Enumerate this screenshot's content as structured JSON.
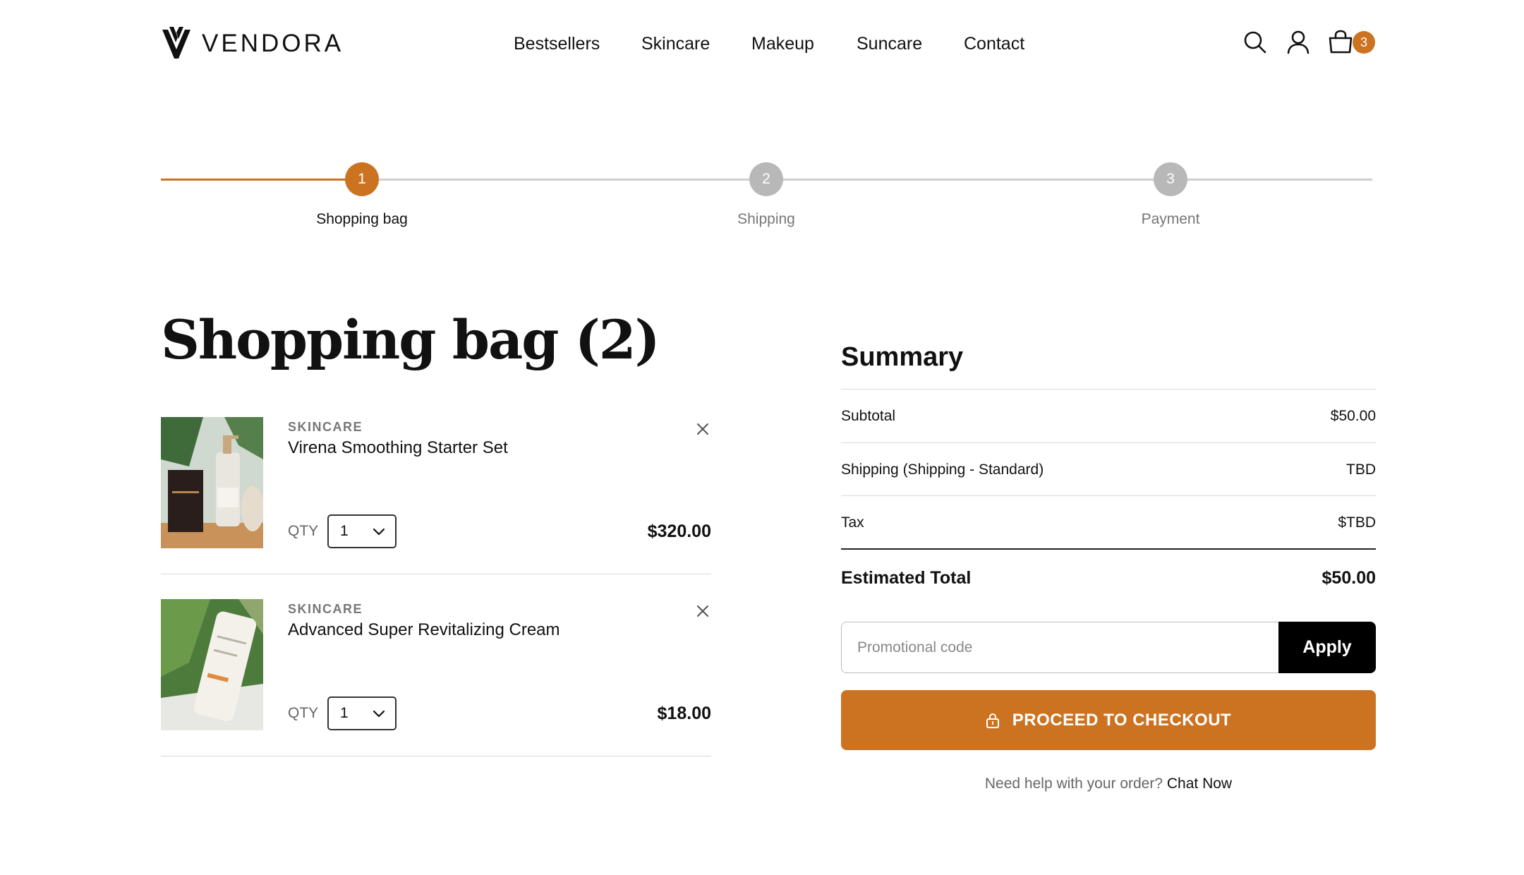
{
  "brand": {
    "name": "VENDORA"
  },
  "nav": {
    "items": [
      "Bestsellers",
      "Skincare",
      "Makeup",
      "Suncare",
      "Contact"
    ]
  },
  "header": {
    "icons": [
      "search-icon",
      "user-icon",
      "shopping-bag-icon"
    ],
    "cart_count": "3"
  },
  "colors": {
    "accent": "#cc7322",
    "inactive_step": "#b8b8b8",
    "dark": "#000000"
  },
  "stepper": {
    "steps": [
      {
        "number": "1",
        "label": "Shopping bag",
        "state": "active"
      },
      {
        "number": "2",
        "label": "Shipping",
        "state": "inactive"
      },
      {
        "number": "3",
        "label": "Payment",
        "state": "inactive"
      }
    ]
  },
  "bag": {
    "title": "Shopping bag (2)",
    "qty_label": "QTY",
    "items": [
      {
        "category": "SKINCARE",
        "name": "Virena Smoothing Starter Set",
        "qty": "1",
        "price": "$320.00"
      },
      {
        "category": "SKINCARE",
        "name": "Advanced Super Revitalizing Cream",
        "qty": "1",
        "price": "$18.00"
      }
    ]
  },
  "summary": {
    "title": "Summary",
    "rows": [
      {
        "label": "Subtotal",
        "value": "$50.00"
      },
      {
        "label": "Shipping (Shipping - Standard)",
        "value": "TBD"
      },
      {
        "label": "Tax",
        "value": "$TBD"
      }
    ],
    "total_label": "Estimated Total",
    "total_value": "$50.00",
    "promo_placeholder": "Promotional code",
    "promo_value": "",
    "apply_label": "Apply",
    "checkout_label": "PROCEED TO CHECKOUT",
    "help_text": "Need help with your order?",
    "help_link": "Chat Now"
  }
}
